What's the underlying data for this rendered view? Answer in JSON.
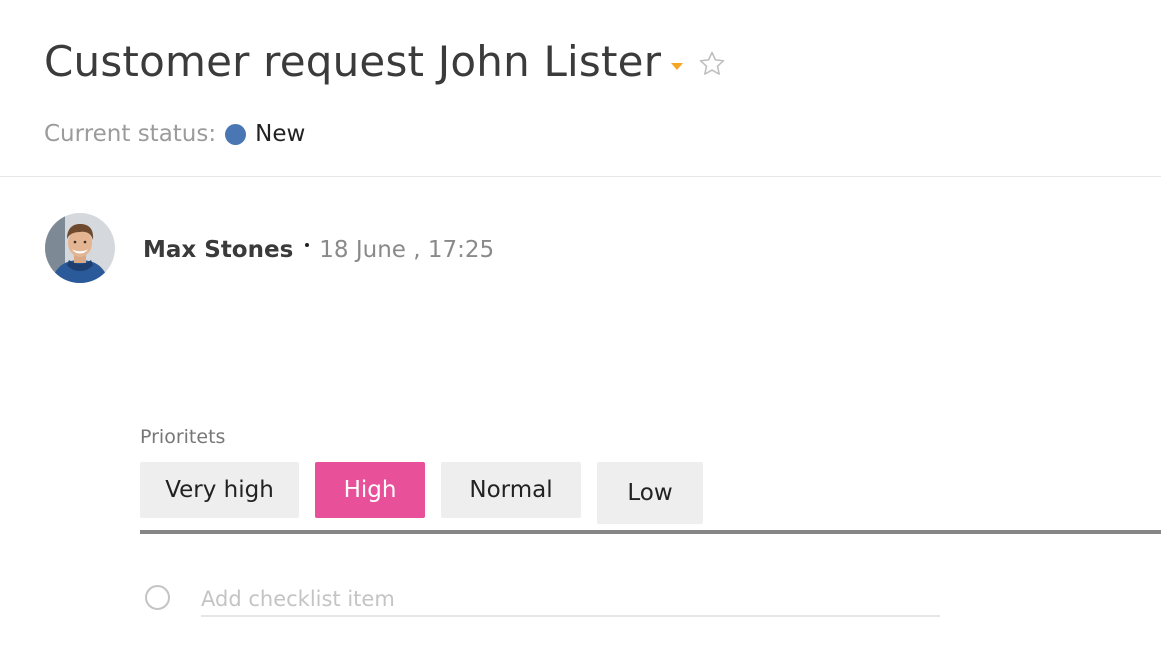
{
  "task": {
    "title": "Customer request John Lister",
    "status_label": "Current status:",
    "status_value": "New",
    "status_color": "#4a76b4"
  },
  "comment": {
    "author": "Max Stones",
    "date": "18 June , 17:25"
  },
  "priority": {
    "label": "Prioritets",
    "options": [
      "Very high",
      "High",
      "Normal",
      "Low"
    ],
    "selected": "High",
    "selected_color": "#e8509a"
  },
  "checklist": {
    "placeholder": "Add checklist item"
  },
  "icons": {
    "title_dropdown": "caret-down-icon",
    "favorite": "star-icon",
    "avatar": "user-avatar",
    "checkbox": "circle-checkbox-icon"
  }
}
